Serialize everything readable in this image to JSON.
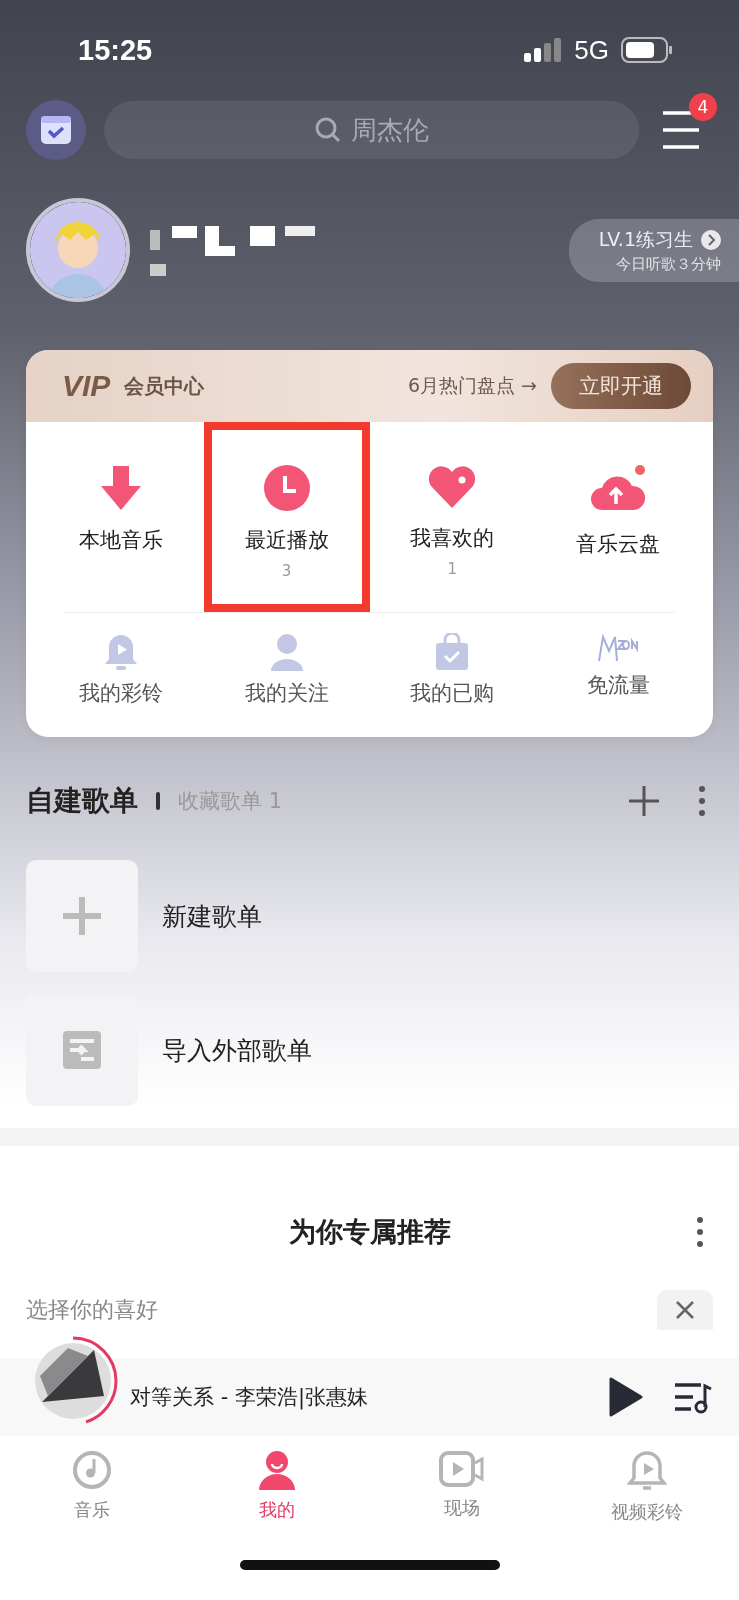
{
  "status_bar": {
    "time": "15:25",
    "network": "5G"
  },
  "top_bar": {
    "search": {
      "placeholder": "周杰伦"
    },
    "menu_badge": "4"
  },
  "profile": {
    "level": "LV.1练习生",
    "listen_today": "今日听歌３分钟"
  },
  "vip": {
    "logo": "VIP",
    "title": "会员中心",
    "promo": "6月热门盘点 →",
    "button": "立即开通"
  },
  "shortcuts": [
    {
      "kind": "download",
      "label": "本地音乐",
      "highlighted": false
    },
    {
      "kind": "clock",
      "label": "最近播放",
      "count": "3",
      "highlighted": true
    },
    {
      "kind": "heart",
      "label": "我喜欢的",
      "count": "1",
      "highlighted": false
    },
    {
      "kind": "cloud",
      "label": "音乐云盘",
      "dot": true,
      "highlighted": false
    }
  ],
  "secondary": [
    {
      "kind": "bell",
      "label": "我的彩铃"
    },
    {
      "kind": "person",
      "label": "我的关注"
    },
    {
      "kind": "bag",
      "label": "我的已购"
    },
    {
      "kind": "mzone",
      "label": "免流量"
    }
  ],
  "playlists": {
    "tabs": [
      {
        "label": "自建歌单",
        "selected": true
      },
      {
        "label": "收藏歌单 1",
        "selected": false
      }
    ],
    "rows": [
      {
        "kind": "plus",
        "label": "新建歌单"
      },
      {
        "kind": "import",
        "label": "导入外部歌单"
      }
    ]
  },
  "recommend": {
    "title": "为你专属推荐",
    "prompt": "选择你的喜好"
  },
  "mini_player": {
    "track": "对等关系 - 李荣浩|张惠妹",
    "level": 0.45
  },
  "tab_bar": [
    {
      "kind": "music",
      "label": "音乐",
      "selected": false
    },
    {
      "kind": "me",
      "label": "我的",
      "selected": true
    },
    {
      "kind": "video",
      "label": "现场",
      "selected": false
    },
    {
      "kind": "ring",
      "label": "视频彩铃",
      "selected": false
    }
  ]
}
